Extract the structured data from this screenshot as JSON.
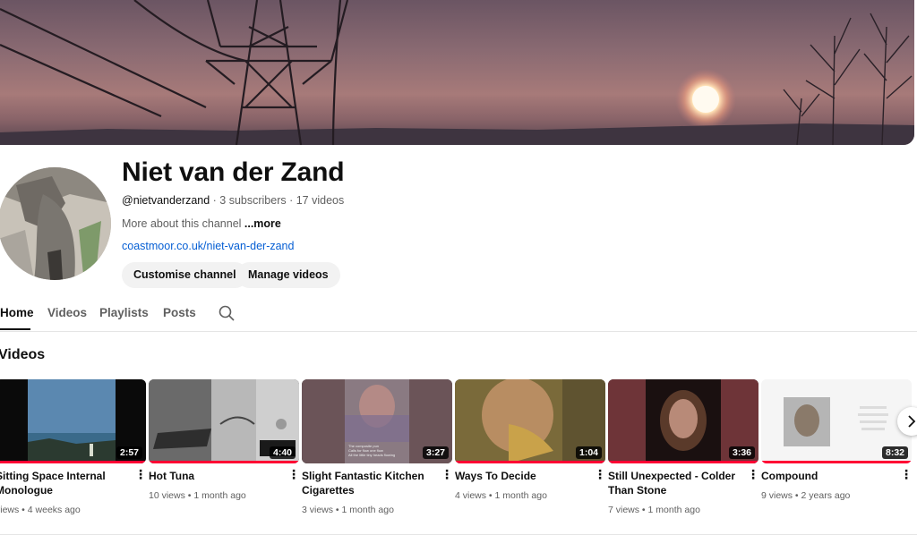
{
  "channel": {
    "name": "Niet van der Zand",
    "handle": "@nietvanderzand",
    "subscribers": " · 3 subscribers",
    "video_count": " · 17 videos",
    "about": "More about this channel ",
    "more_label": "...more",
    "link": "coastmoor.co.uk/niet-van-der-zand"
  },
  "buttons": {
    "customise": "Customise channel",
    "manage": "Manage videos"
  },
  "tabs": [
    {
      "label": "Home",
      "active": true
    },
    {
      "label": "Videos"
    },
    {
      "label": "Playlists"
    },
    {
      "label": "Posts"
    }
  ],
  "tab_search_icon": "search-icon",
  "section": {
    "title": "Videos"
  },
  "videos": [
    {
      "title": "Sitting Space Internal Monologue",
      "views": "views",
      "age": "4 weeks ago",
      "duration": "2:57",
      "progress": 1.0
    },
    {
      "title": "Hot Tuna",
      "views": "10 views",
      "age": "1 month ago",
      "duration": "4:40",
      "progress": 1.0
    },
    {
      "title": "Slight Fantastic Kitchen Cigarettes",
      "views": "3 views",
      "age": "1 month ago",
      "duration": "3:27",
      "progress": 0
    },
    {
      "title": "Ways To Decide",
      "views": "4 views",
      "age": "1 month ago",
      "duration": "1:04",
      "progress": 1.0
    },
    {
      "title": "Still Unexpected - Colder Than Stone",
      "views": "7 views",
      "age": "1 month ago",
      "duration": "3:36",
      "progress": 1.0
    },
    {
      "title": "Compound",
      "views": "9 views",
      "age": "2 years ago",
      "duration": "8:32",
      "progress": 1.0
    }
  ],
  "thumb_text": {
    "line1": "The composite pun",
    "line2": "Calls for flow one flow",
    "line3": "All the little tiny heads flowing"
  },
  "colors": {
    "link": "#065fd4",
    "progress": "#ff0033",
    "button_bg": "#f2f2f2"
  },
  "icons": {
    "kebab": "more-vert-icon",
    "next": "chevron-right-icon"
  }
}
